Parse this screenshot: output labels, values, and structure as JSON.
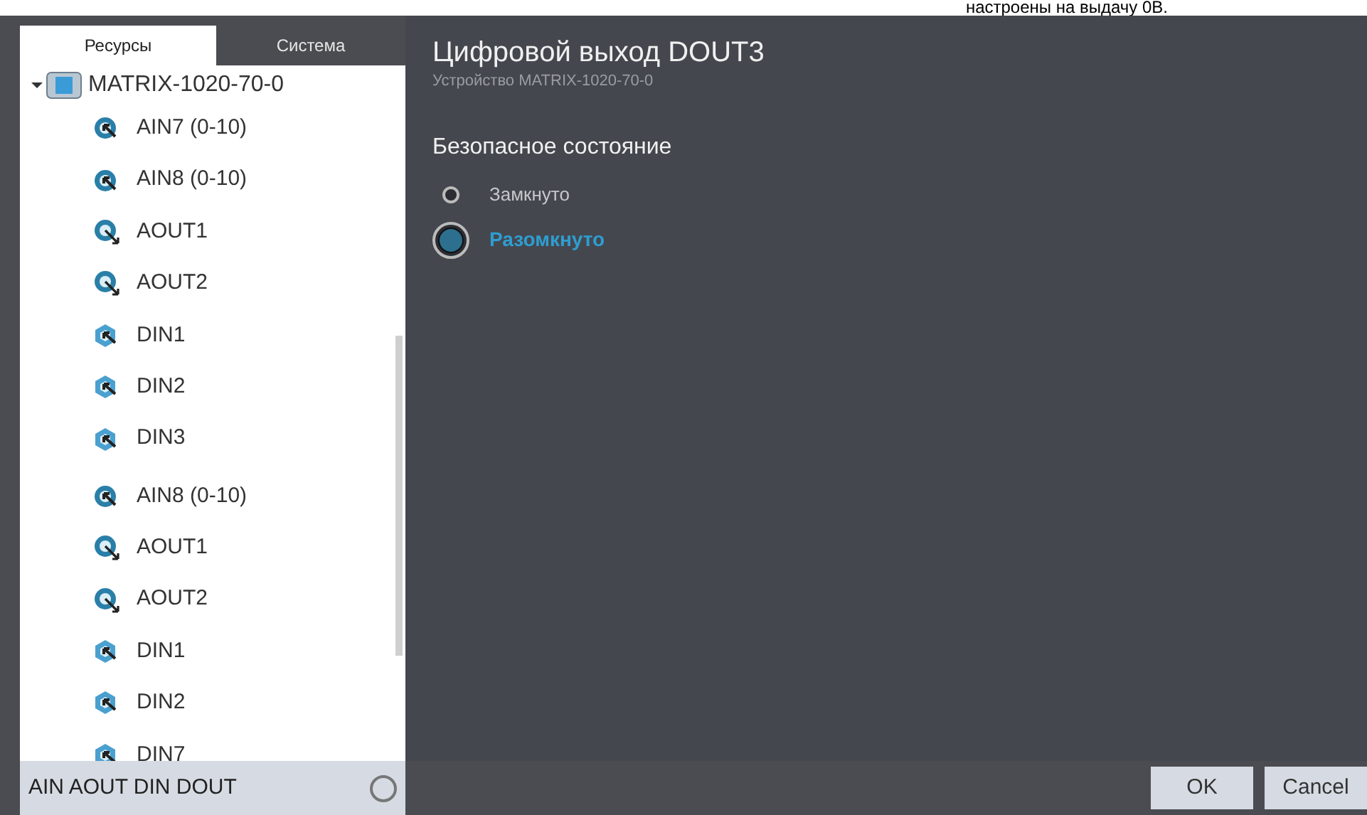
{
  "top_note": "настроены на выдачу 0В.",
  "tabs": [
    {
      "label": "Ресурсы",
      "selected": true
    },
    {
      "label": "Система",
      "selected": false
    }
  ],
  "tree": [
    {
      "label": "MATRIX-1020-70-0",
      "kind": "device",
      "expanded": true,
      "children": [
        {
          "label": "AIN7 (0-10)",
          "kind": "ain"
        },
        {
          "label": "AIN8 (0-10)",
          "kind": "ain"
        },
        {
          "label": "AOUT1",
          "kind": "aout"
        },
        {
          "label": "AOUT2",
          "kind": "aout"
        },
        {
          "label": "DIN1",
          "kind": "din"
        },
        {
          "label": "DIN2",
          "kind": "din"
        },
        {
          "label": "DIN3",
          "kind": "din"
        },
        {
          "label": "AIN8 (0-10)",
          "kind": "ain"
        },
        {
          "label": "AOUT1",
          "kind": "aout"
        },
        {
          "label": "AOUT2",
          "kind": "aout"
        },
        {
          "label": "DIN1",
          "kind": "din"
        },
        {
          "label": "DIN2",
          "kind": "din"
        },
        {
          "label": "DIN7",
          "kind": "din"
        }
      ]
    }
  ],
  "filter_bar": {
    "label": "AIN AOUT DIN DOUT"
  },
  "detail": {
    "title": "Цифровой выход DOUT3",
    "subtitle": "Устройство MATRIX-1020-70-0",
    "section": "Безопасное состояние",
    "options": [
      {
        "label": "Замкнуто",
        "selected": false
      },
      {
        "label": "Разомкнуто",
        "selected": true
      }
    ]
  },
  "buttons": [
    "OK",
    "Cancel"
  ]
}
